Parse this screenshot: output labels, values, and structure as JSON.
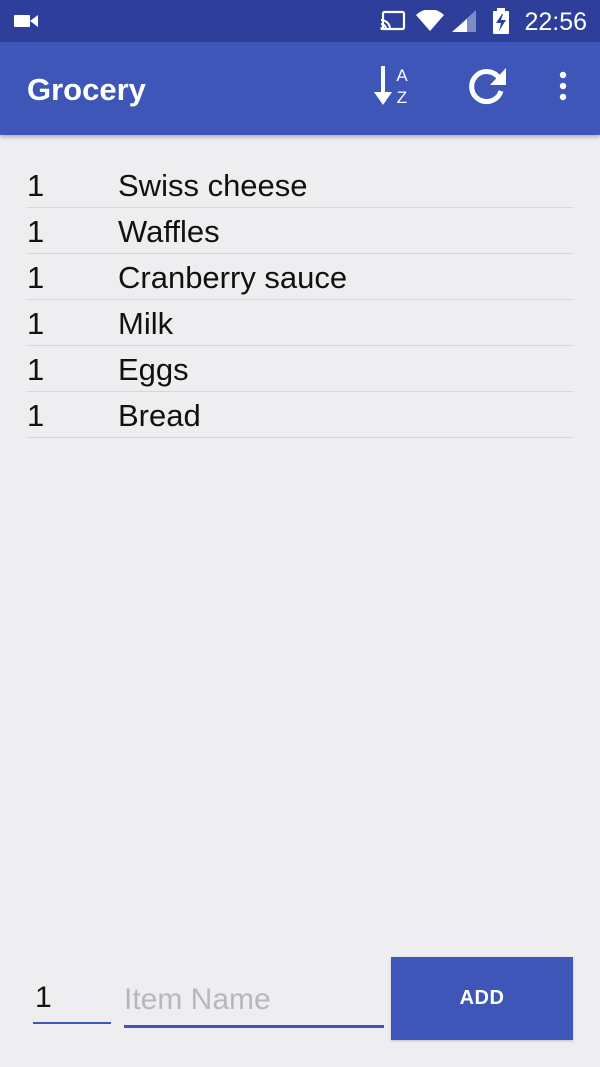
{
  "colors": {
    "status_bar": "#2d3f9a",
    "app_bar": "#3d56b8",
    "accent": "#3d56b8",
    "background": "#eeedf0"
  },
  "status_bar": {
    "time": "22:56",
    "icons": [
      "video-camera-icon",
      "cast-icon",
      "wifi-icon",
      "cell-signal-icon",
      "battery-charging-icon"
    ]
  },
  "app_bar": {
    "title": "Grocery",
    "actions": [
      "sort-az-icon",
      "refresh-icon",
      "overflow-menu-icon"
    ]
  },
  "list": {
    "items": [
      {
        "qty": "1",
        "name": "Swiss cheese"
      },
      {
        "qty": "1",
        "name": "Waffles"
      },
      {
        "qty": "1",
        "name": "Cranberry sauce"
      },
      {
        "qty": "1",
        "name": "Milk"
      },
      {
        "qty": "1",
        "name": "Eggs"
      },
      {
        "qty": "1",
        "name": "Bread"
      }
    ]
  },
  "form": {
    "qty_value": "1",
    "name_placeholder": "Item Name",
    "add_label": "ADD"
  }
}
